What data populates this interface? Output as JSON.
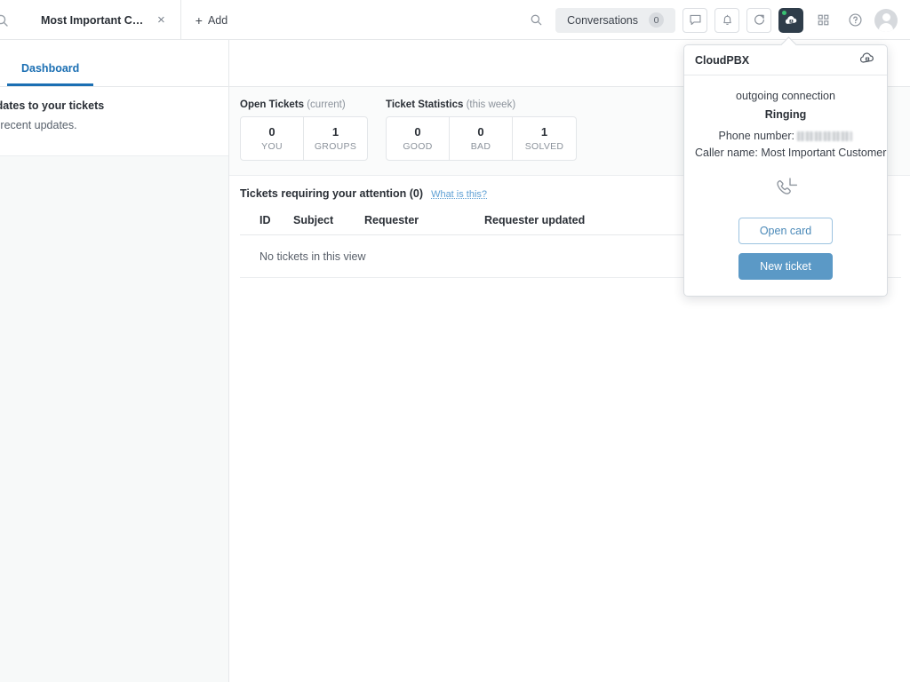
{
  "topbar": {
    "search_icon": "search-icon",
    "tab": {
      "title": "Most Important Custo...",
      "close_label": "×"
    },
    "add": {
      "plus": "+",
      "label": "Add"
    },
    "conversations": {
      "label": "Conversations",
      "count": "0"
    },
    "icons": {
      "chat": "chat-bubble-icon",
      "bell": "bell-icon",
      "refresh": "refresh-icon",
      "cloudpbx": "cloud-phone-icon",
      "apps": "grid-apps-icon",
      "help": "question-mark-icon",
      "avatar": "user-avatar-icon"
    },
    "accent_dark": "#2f3d4a",
    "status_green": "#38c172"
  },
  "left_panel": {
    "tab_label": "Dashboard",
    "heading": "pdates to your tickets",
    "subtext": "o recent updates."
  },
  "main": {
    "open_tickets": {
      "title": "Open Tickets",
      "subtitle": "(current)",
      "boxes": [
        {
          "value": "0",
          "label": "YOU"
        },
        {
          "value": "1",
          "label": "GROUPS"
        }
      ]
    },
    "ticket_statistics": {
      "title": "Ticket Statistics",
      "subtitle": "(this week)",
      "boxes": [
        {
          "value": "0",
          "label": "GOOD"
        },
        {
          "value": "0",
          "label": "BAD"
        },
        {
          "value": "1",
          "label": "SOLVED"
        }
      ]
    },
    "attention": {
      "title": "Tickets requiring your attention (0)",
      "link": "What is this?",
      "columns": [
        "ID",
        "Subject",
        "Requester",
        "Requester updated"
      ],
      "empty_text": "No tickets in this view"
    }
  },
  "popover": {
    "title": "CloudPBX",
    "header_icon": "cloud-phone-icon",
    "connection_type": "outgoing connection",
    "state": "Ringing",
    "phone_label": "Phone number:",
    "phone_value_redacted": true,
    "caller_label": "Caller name:",
    "caller_value": "Most Important Customer",
    "call_icon": "outgoing-call-icon",
    "buttons": {
      "open_card": "Open card",
      "new_ticket": "New ticket"
    },
    "accent_blue": "#5b99c6"
  }
}
